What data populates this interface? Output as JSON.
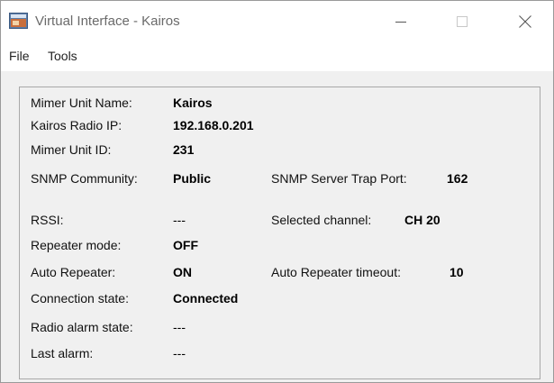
{
  "window": {
    "title": "Virtual Interface - Kairos"
  },
  "menu": {
    "file": "File",
    "tools": "Tools"
  },
  "fields": {
    "unit_name": {
      "label": "Mimer Unit Name:",
      "value": "Kairos"
    },
    "radio_ip": {
      "label": "Kairos Radio IP:",
      "value": "192.168.0.201"
    },
    "unit_id": {
      "label": "Mimer Unit ID:",
      "value": "231"
    },
    "snmp_community": {
      "label": "SNMP Community:",
      "value": "Public"
    },
    "snmp_trap_port": {
      "label": "SNMP Server Trap Port:",
      "value": "162"
    },
    "rssi": {
      "label": "RSSI:",
      "value": "---"
    },
    "selected_channel": {
      "label": "Selected channel:",
      "value": "CH 20"
    },
    "repeater_mode": {
      "label": "Repeater mode:",
      "value": "OFF"
    },
    "auto_repeater": {
      "label": "Auto Repeater:",
      "value": "ON"
    },
    "auto_repeater_timeout": {
      "label": "Auto Repeater timeout:",
      "value": "10"
    },
    "connection_state": {
      "label": "Connection state:",
      "value": "Connected"
    },
    "radio_alarm_state": {
      "label": "Radio alarm state:",
      "value": "---"
    },
    "last_alarm": {
      "label": "Last alarm:",
      "value": "---"
    }
  },
  "icons": {
    "app": "app-icon",
    "minimize": "minimize-icon",
    "maximize": "maximize-icon",
    "close": "close-icon"
  }
}
